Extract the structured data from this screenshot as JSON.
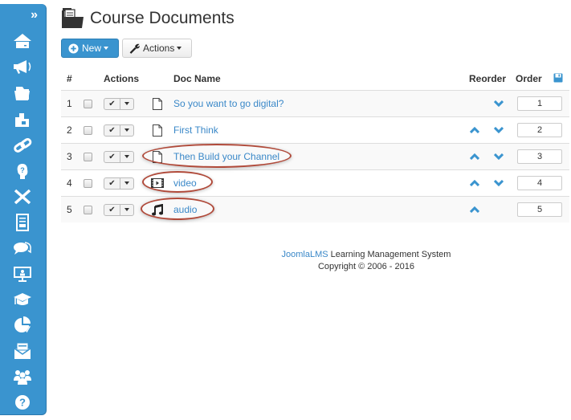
{
  "header": {
    "title": "Course Documents",
    "new_label": "New",
    "actions_label": "Actions"
  },
  "sidebar": {
    "toggle": "»",
    "items": [
      {
        "icon": "home-icon"
      },
      {
        "icon": "megaphone-icon"
      },
      {
        "icon": "folder-icon"
      },
      {
        "icon": "puzzle-icon"
      },
      {
        "icon": "link-icon"
      },
      {
        "icon": "question-head-icon"
      },
      {
        "icon": "pencil-ruler-icon"
      },
      {
        "icon": "document-list-icon"
      },
      {
        "icon": "chat-icon"
      },
      {
        "icon": "presentation-icon"
      },
      {
        "icon": "graduation-cap-icon"
      },
      {
        "icon": "pie-chart-icon"
      },
      {
        "icon": "mail-icon"
      },
      {
        "icon": "users-icon"
      },
      {
        "icon": "help-icon"
      }
    ]
  },
  "table": {
    "columns": {
      "num": "#",
      "actions": "Actions",
      "doc_name": "Doc Name",
      "reorder": "Reorder",
      "order": "Order"
    },
    "rows": [
      {
        "num": "1",
        "type": "document",
        "name": "So you want to go digital?",
        "up": false,
        "down": true,
        "order": "1",
        "highlighted": false
      },
      {
        "num": "2",
        "type": "document",
        "name": "First Think",
        "up": true,
        "down": true,
        "order": "2",
        "highlighted": false
      },
      {
        "num": "3",
        "type": "document",
        "name": "Then Build your Channel",
        "up": true,
        "down": true,
        "order": "3",
        "highlighted": true
      },
      {
        "num": "4",
        "type": "video",
        "name": "video",
        "up": true,
        "down": true,
        "order": "4",
        "highlighted": true
      },
      {
        "num": "5",
        "type": "audio",
        "name": "audio",
        "up": true,
        "down": false,
        "order": "5",
        "highlighted": true
      }
    ]
  },
  "footer": {
    "brand": "JoomlaLMS",
    "line1_rest": " Learning Management System",
    "line2": "Copyright © 2006 - 2016"
  },
  "colors": {
    "accent": "#3a94cf",
    "link": "#3a88c8",
    "highlight_ring": "#b04a3a"
  }
}
